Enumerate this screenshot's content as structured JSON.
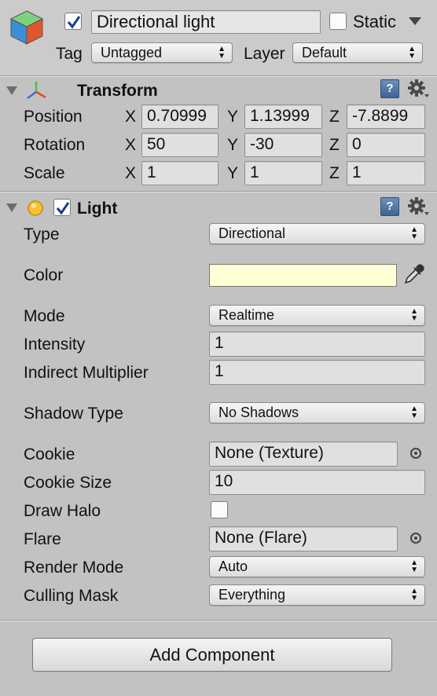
{
  "header": {
    "active_checked": true,
    "name": "Directional light",
    "static_label": "Static",
    "static_checked": false,
    "tag_label": "Tag",
    "tag_value": "Untagged",
    "layer_label": "Layer",
    "layer_value": "Default"
  },
  "transform": {
    "title": "Transform",
    "position_label": "Position",
    "rotation_label": "Rotation",
    "scale_label": "Scale",
    "axis_x": "X",
    "axis_y": "Y",
    "axis_z": "Z",
    "position": {
      "x": "0.70999",
      "y": "1.13999",
      "z": "-7.8899"
    },
    "rotation": {
      "x": "50",
      "y": "-30",
      "z": "0"
    },
    "scale": {
      "x": "1",
      "y": "1",
      "z": "1"
    }
  },
  "light": {
    "title": "Light",
    "enabled": true,
    "type_label": "Type",
    "type_value": "Directional",
    "color_label": "Color",
    "color_value": "#ffffd5",
    "mode_label": "Mode",
    "mode_value": "Realtime",
    "intensity_label": "Intensity",
    "intensity_value": "1",
    "indirect_label": "Indirect Multiplier",
    "indirect_value": "1",
    "shadow_label": "Shadow Type",
    "shadow_value": "No Shadows",
    "cookie_label": "Cookie",
    "cookie_value": "None (Texture)",
    "cookie_size_label": "Cookie Size",
    "cookie_size_value": "10",
    "draw_halo_label": "Draw Halo",
    "draw_halo_checked": false,
    "flare_label": "Flare",
    "flare_value": "None (Flare)",
    "render_mode_label": "Render Mode",
    "render_mode_value": "Auto",
    "culling_label": "Culling Mask",
    "culling_value": "Everything"
  },
  "footer": {
    "add_component_label": "Add Component"
  }
}
